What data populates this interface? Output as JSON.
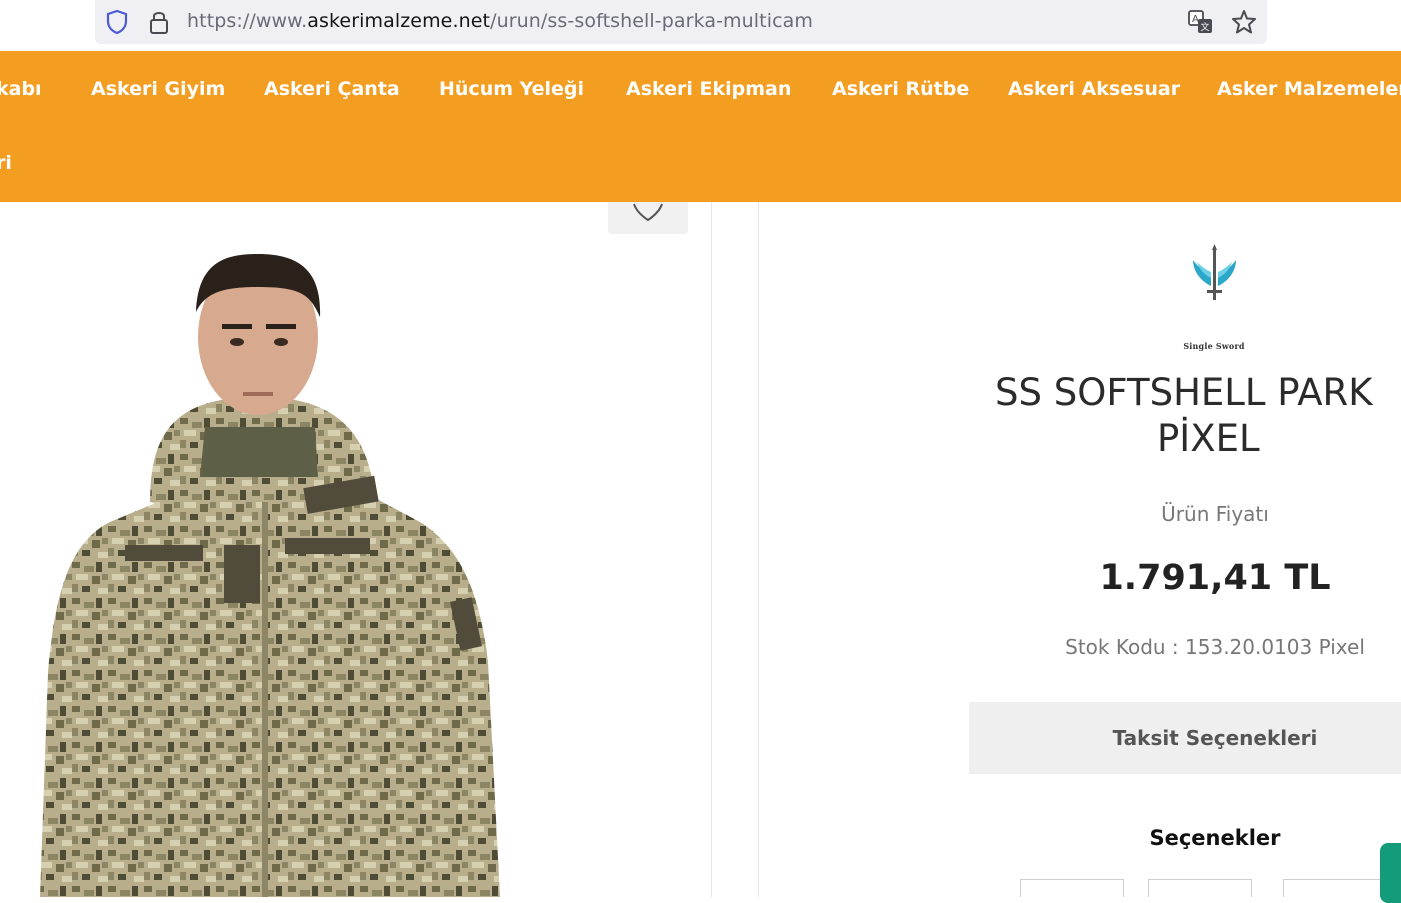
{
  "browser": {
    "url_prefix": "https://www.",
    "url_host": "askerimalzeme.net",
    "url_path": "/urun/ss-softshell-parka-multicam"
  },
  "nav": {
    "items": [
      "kabı",
      "Askeri Giyim",
      "Askeri Çanta",
      "Hücum Yeleği",
      "Askeri Ekipman",
      "Askeri Rütbe",
      "Askeri Aksesuar",
      "Asker Malzemeler"
    ],
    "row2_item": "ri"
  },
  "product": {
    "brand": "Single Sword",
    "title_line1": "SS SOFTSHELL PARK",
    "title_line2": "PİXEL",
    "price_label": "Ürün Fiyatı",
    "price": "1.791,41 TL",
    "stock": "Stok Kodu : 153.20.0103 Pixel",
    "installments_label": "Taksit Seçenekleri",
    "options_title": "Seçenekler"
  },
  "colors": {
    "nav_bg": "#f39d21",
    "chat_accent": "#149c7a"
  },
  "icons": [
    "shield-icon",
    "lock-icon",
    "translate-icon",
    "bookmark-star-icon",
    "heart-icon",
    "brand-logo"
  ]
}
